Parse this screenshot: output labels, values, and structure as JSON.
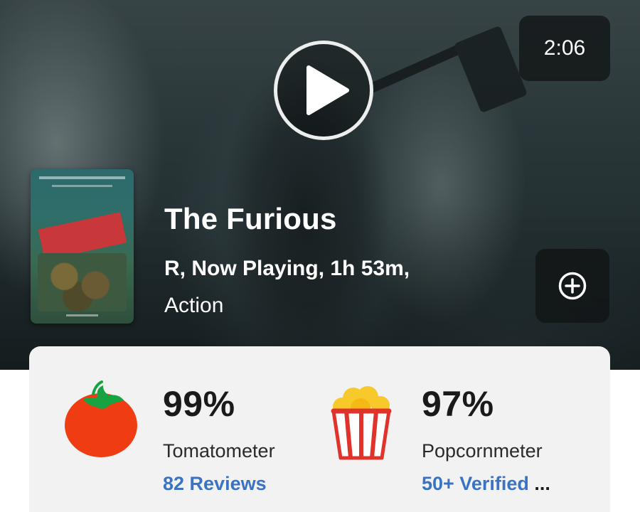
{
  "trailer": {
    "duration": "2:06"
  },
  "movie": {
    "title": "The Furious",
    "meta": "R, Now Playing, 1h 53m,",
    "genre": "Action"
  },
  "scores": {
    "tomatometer": {
      "percent": "99%",
      "label": "Tomatometer",
      "link": "82 Reviews",
      "icon": "tomato-icon"
    },
    "popcornmeter": {
      "percent": "97%",
      "label": "Popcornmeter",
      "link": "50+ Verified",
      "link_ellipsis": "...",
      "icon": "popcorn-icon"
    }
  },
  "icons": {
    "play": "play-icon",
    "add": "plus-circle-icon"
  },
  "colors": {
    "link_blue": "#3a73c4",
    "tomato_red": "#f03c13",
    "popcorn_red": "#e0332b",
    "popcorn_yellow": "#f7c92b"
  }
}
